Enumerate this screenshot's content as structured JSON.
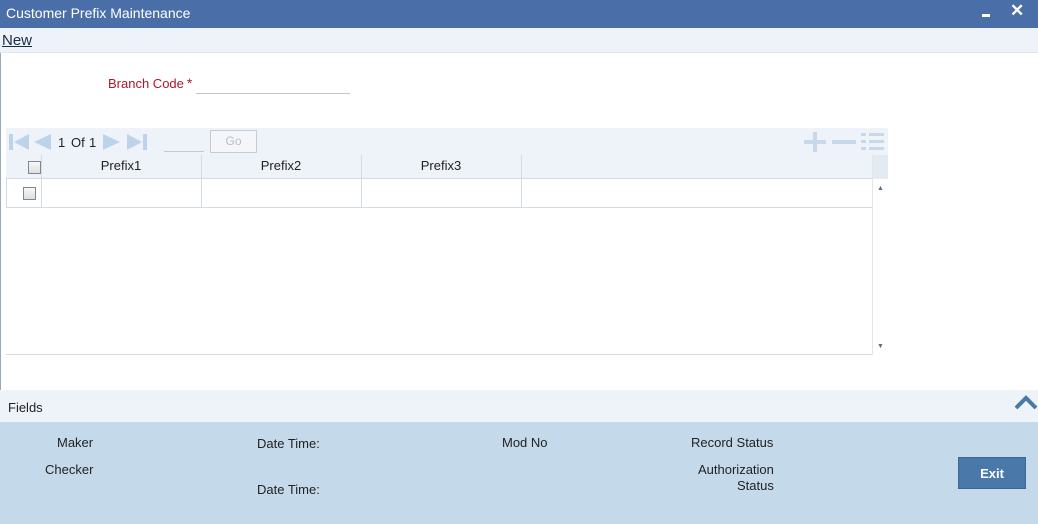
{
  "window": {
    "title": "Customer Prefix Maintenance"
  },
  "menu": {
    "new_label": "New"
  },
  "form": {
    "branch_code_label": "Branch Code",
    "required_mark": "*",
    "branch_code_value": ""
  },
  "pager": {
    "current": "1",
    "of_label": "Of",
    "total": "1",
    "go_label": "Go"
  },
  "grid": {
    "columns": [
      "Prefix1",
      "Prefix2",
      "Prefix3"
    ],
    "rows": [
      {
        "prefix1": "",
        "prefix2": "",
        "prefix3": ""
      }
    ]
  },
  "fields_bar": {
    "label": "Fields"
  },
  "footer": {
    "maker_label": "Maker",
    "checker_label": "Checker",
    "date_time_label_1": "Date Time:",
    "date_time_label_2": "Date Time:",
    "mod_no_label": "Mod No",
    "record_status_label": "Record Status",
    "auth_status_line1": "Authorization",
    "auth_status_line2": "Status",
    "exit_label": "Exit"
  },
  "colors": {
    "title_bar": "#4a6fa8",
    "required_label": "#b0162b",
    "footer_bg": "#c4daea",
    "exit_button": "#4a78a8"
  },
  "icons": [
    "minimize-icon",
    "close-icon",
    "first-page-icon",
    "prev-page-icon",
    "next-page-icon",
    "last-page-icon",
    "add-row-icon",
    "delete-row-icon",
    "single-record-view-icon",
    "collapse-up-icon"
  ]
}
